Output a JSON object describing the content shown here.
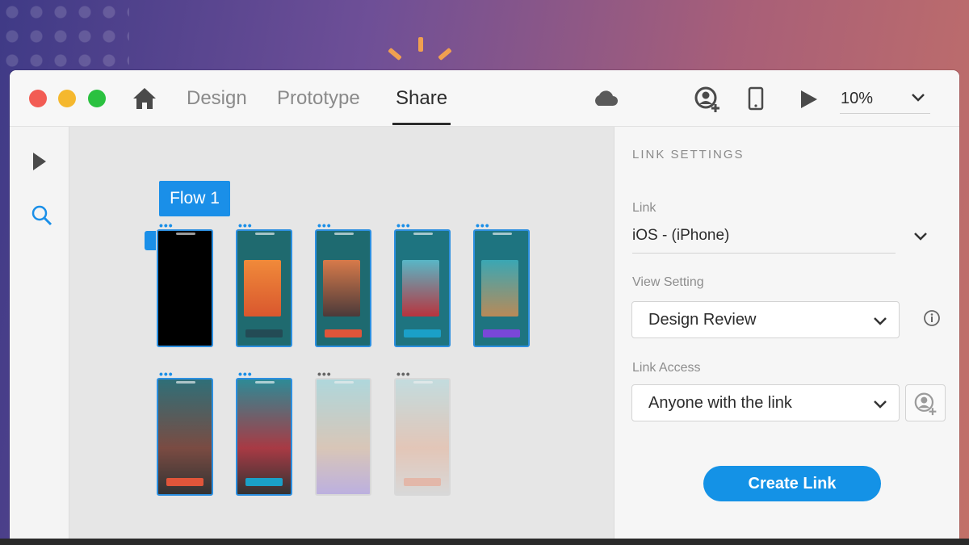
{
  "toolbar": {
    "tabs": [
      {
        "label": "Design",
        "active": false
      },
      {
        "label": "Prototype",
        "active": false
      },
      {
        "label": "Share",
        "active": true
      }
    ],
    "zoom": "10%",
    "icons": [
      "home-icon",
      "cloud-icon",
      "user-plus-icon",
      "phone-icon",
      "play-icon",
      "chevron-down-icon"
    ]
  },
  "window_controls": {
    "close": "#f25c54",
    "minimize": "#f5b82e",
    "maximize": "#2bc140"
  },
  "leftbar": {
    "tools": [
      "select-arrow-icon",
      "search-icon"
    ]
  },
  "canvas": {
    "flow_label": "Flow 1",
    "accent": "#1a8fe8"
  },
  "panel": {
    "title": "LINK SETTINGS",
    "link_label": "Link",
    "link_value": "iOS - (iPhone)",
    "view_setting_label": "View Setting",
    "view_setting_value": "Design Review",
    "link_access_label": "Link Access",
    "link_access_value": "Anyone with the link",
    "create_button": "Create Link",
    "button_color": "#1492e6"
  }
}
